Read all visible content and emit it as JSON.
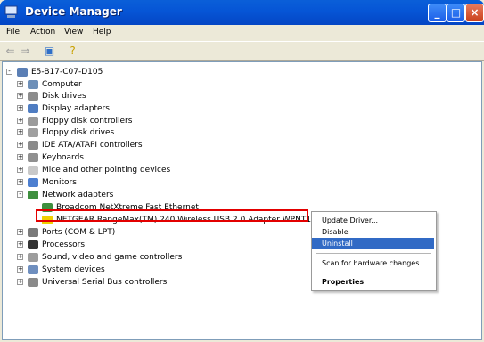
{
  "window": {
    "title": "Device Manager"
  },
  "menu": [
    "File",
    "Action",
    "View",
    "Help"
  ],
  "tree": {
    "root": "E5-B17-C07-D105",
    "categories": [
      {
        "label": "Computer",
        "icon": "computer-icon",
        "color": "#6d8fb8",
        "expander": "+"
      },
      {
        "label": "Disk drives",
        "icon": "disk-drive-icon",
        "color": "#8c8c8c",
        "expander": "+"
      },
      {
        "label": "Display adapters",
        "icon": "display-adapter-icon",
        "color": "#4f7dc2",
        "expander": "+"
      },
      {
        "label": "Floppy disk controllers",
        "icon": "floppy-controller-icon",
        "color": "#9b9b9b",
        "expander": "+"
      },
      {
        "label": "Floppy disk drives",
        "icon": "floppy-drive-icon",
        "color": "#a0a0a0",
        "expander": "+"
      },
      {
        "label": "IDE ATA/ATAPI controllers",
        "icon": "ide-controller-icon",
        "color": "#8b8b8b",
        "expander": "+"
      },
      {
        "label": "Keyboards",
        "icon": "keyboard-icon",
        "color": "#909090",
        "expander": "+"
      },
      {
        "label": "Mice and other pointing devices",
        "icon": "mouse-icon",
        "color": "#c9c9c9",
        "expander": "+"
      },
      {
        "label": "Monitors",
        "icon": "monitor-icon",
        "color": "#4d7fd0",
        "expander": "+"
      },
      {
        "label": "Network adapters",
        "icon": "network-adapter-icon",
        "color": "#3e8f3e",
        "expander": "-"
      },
      {
        "label": "Broadcom NetXtreme Fast Ethernet",
        "icon": "ethernet-card-icon",
        "color": "#3e8f3e",
        "child": true
      },
      {
        "label": "NETGEAR RangeMax(TM) 240 Wireless USB 2.0 Adapter WPNT121",
        "icon": "warning-adapter-icon",
        "color": "#f0d000",
        "child": true
      },
      {
        "label": "Ports (COM & LPT)",
        "icon": "port-icon",
        "color": "#7a7a7a",
        "expander": "+"
      },
      {
        "label": "Processors",
        "icon": "processor-icon",
        "color": "#333333",
        "expander": "+"
      },
      {
        "label": "Sound, video and game controllers",
        "icon": "sound-icon",
        "color": "#9d9d9d",
        "expander": "+"
      },
      {
        "label": "System devices",
        "icon": "system-device-icon",
        "color": "#6f8fbf",
        "expander": "+"
      },
      {
        "label": "Universal Serial Bus controllers",
        "icon": "usb-icon",
        "color": "#8a8a8a",
        "expander": "+"
      }
    ]
  },
  "context_menu": {
    "update": "Update Driver...",
    "disable": "Disable",
    "uninstall": "Uninstall",
    "scan": "Scan for hardware changes",
    "properties": "Properties"
  }
}
